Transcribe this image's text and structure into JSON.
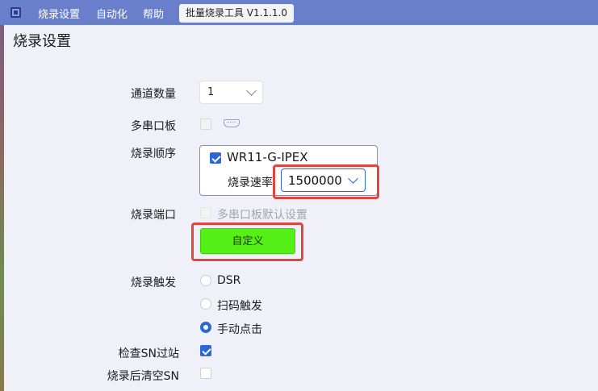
{
  "menubar": {
    "items": [
      "烧录设置",
      "自动化",
      "帮助"
    ],
    "window_title": "批量烧录工具 V1.1.1.0"
  },
  "page": {
    "title": "烧录设置"
  },
  "form": {
    "channel_count": {
      "label": "通道数量",
      "value": "1"
    },
    "multi_serial_board": {
      "label": "多串口板",
      "checked": false
    },
    "burn_order": {
      "label": "烧录顺序",
      "device": {
        "name": "WR11-G-IPEX",
        "checked": true
      },
      "baud_rate": {
        "label": "烧录速率",
        "value": "1500000"
      }
    },
    "burn_port": {
      "label": "烧录端口",
      "default_option": "多串口板默认设置",
      "custom_button": "自定义"
    },
    "burn_trigger": {
      "label": "烧录触发",
      "options": [
        "DSR",
        "扫码触发",
        "手动点击"
      ],
      "selected": "手动点击"
    },
    "check_sn": {
      "label": "检查SN过站",
      "checked": true
    },
    "clear_sn": {
      "label": "烧录后清空SN",
      "checked": false
    }
  },
  "colors": {
    "menubar": "#6a7fcc",
    "accent": "#2c67d8",
    "custom_button": "#55f016",
    "highlight_frame": "#e0463c"
  }
}
